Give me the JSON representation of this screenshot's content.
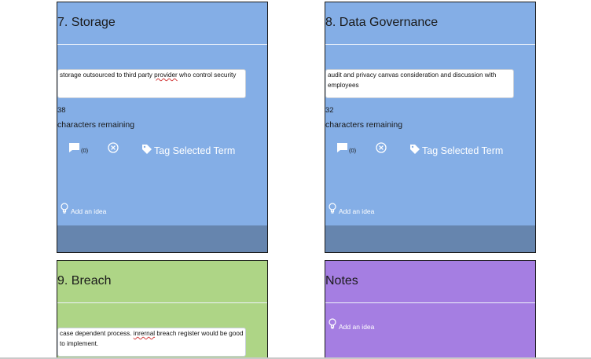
{
  "cards": {
    "storage": {
      "title": "7. Storage",
      "answer_parts": [
        "storage outsourced to third party ",
        "provider",
        " who control security"
      ],
      "chars_count": "38",
      "chars_label": "characters remaining",
      "comment_count": "(0)",
      "tag_label": "Tag Selected Term",
      "idea_label": "Add an idea"
    },
    "governance": {
      "title": "8. Data Governance",
      "answer_parts": [
        "audit and privacy canvas consideration and discussion with employees"
      ],
      "chars_count": "32",
      "chars_label": "characters remaining",
      "comment_count": "(0)",
      "tag_label": "Tag Selected Term",
      "idea_label": "Add an idea"
    },
    "breach": {
      "title": "9. Breach",
      "answer_parts": [
        "case dependent process. ",
        "inrernal",
        " breach register would be good to implement."
      ]
    },
    "notes": {
      "title": "Notes",
      "idea_label": "Add an idea"
    }
  },
  "colors": {
    "card_blue": "#84aee6",
    "card_green": "#aed586",
    "card_purple": "#a57ee2",
    "card_footer": "#6685ae"
  },
  "icons": {
    "comment": "comment-bubble-icon",
    "clear": "circle-x-icon",
    "tag": "tag-icon",
    "idea": "lightbulb-icon"
  }
}
